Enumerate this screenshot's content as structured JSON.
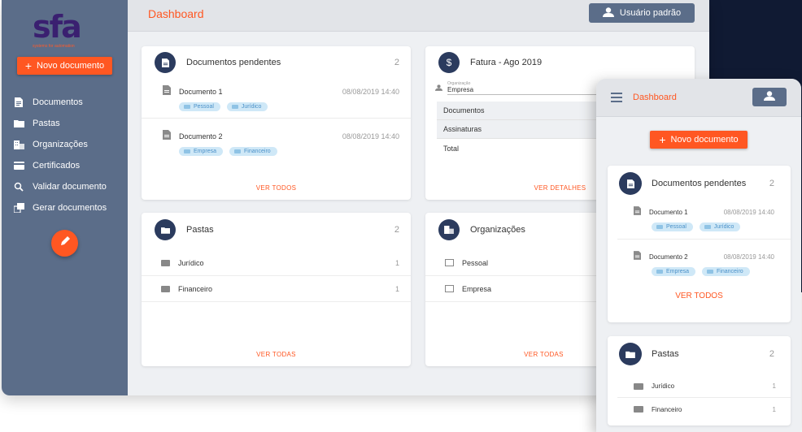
{
  "sidebar": {
    "logo": "sfa",
    "logo_sub": "systems for automation",
    "new_doc": "Novo documento",
    "items": [
      {
        "label": "Documentos",
        "icon": "document-icon"
      },
      {
        "label": "Pastas",
        "icon": "folder-icon"
      },
      {
        "label": "Organizações",
        "icon": "organization-icon"
      },
      {
        "label": "Certificados",
        "icon": "card-icon"
      },
      {
        "label": "Validar documento",
        "icon": "search-icon"
      },
      {
        "label": "Gerar documentos",
        "icon": "copy-icon"
      }
    ]
  },
  "header": {
    "title": "Dashboard",
    "user": "Usuário padrão"
  },
  "pending": {
    "title": "Documentos pendentes",
    "count": "2",
    "docs": [
      {
        "name": "Documento 1",
        "date": "08/08/2019 14:40",
        "tags": [
          "Pessoal",
          "Jurídico"
        ]
      },
      {
        "name": "Documento 2",
        "date": "08/08/2019 14:40",
        "tags": [
          "Empresa",
          "Financeiro"
        ]
      }
    ],
    "footer": "VER TODOS"
  },
  "invoice": {
    "title": "Fatura - Ago 2019",
    "org_label": "Organização",
    "org_value": "Empresa",
    "rows": [
      "Documentos",
      "Assinaturas",
      "Total"
    ],
    "footer": "VER DETALHES"
  },
  "folders": {
    "title": "Pastas",
    "count": "2",
    "items": [
      {
        "name": "Jurídico",
        "count": "1"
      },
      {
        "name": "Financeiro",
        "count": "1"
      }
    ],
    "footer": "VER TODAS"
  },
  "orgs": {
    "title": "Organizações",
    "items": [
      {
        "name": "Pessoal"
      },
      {
        "name": "Empresa"
      }
    ],
    "footer": "VER TODAS"
  },
  "mobile": {
    "title": "Dashboard",
    "new_doc": "Novo documento",
    "pending_title": "Documentos pendentes",
    "pending_count": "2",
    "pending_footer": "VER TODOS",
    "folders_title": "Pastas",
    "folders_count": "2"
  },
  "colors": {
    "accent": "#ff5722",
    "sidebar": "#5b6d89",
    "badge": "#2b3b5e"
  }
}
